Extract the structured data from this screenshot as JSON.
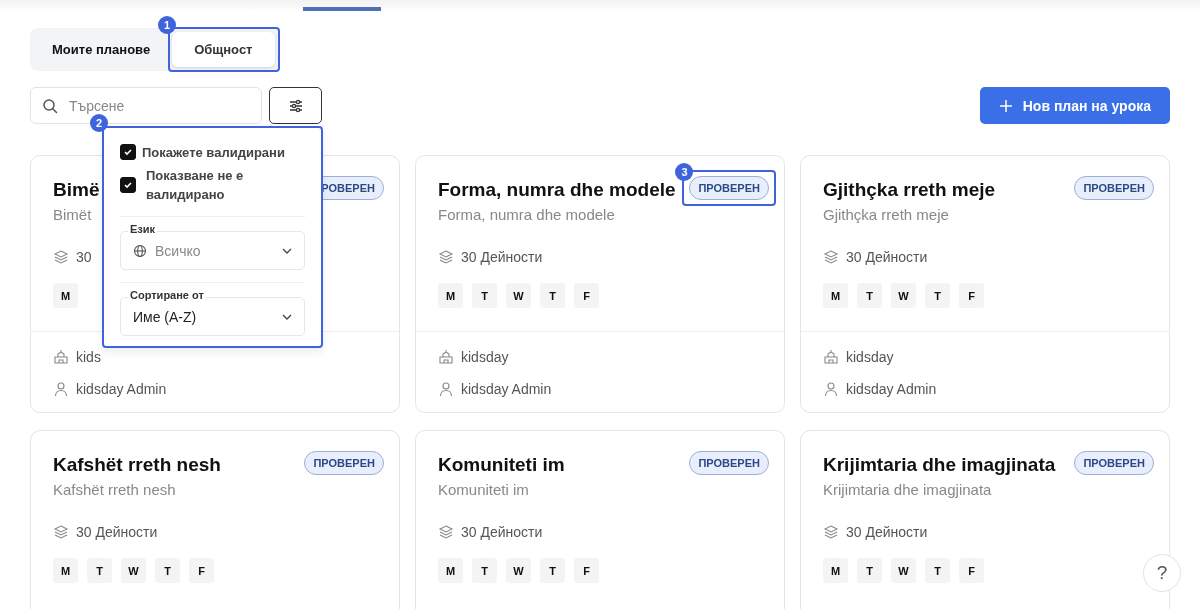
{
  "tabs": [
    {
      "label": "Моите планове",
      "selected": false
    },
    {
      "label": "Общност",
      "selected": true,
      "callout": "1"
    }
  ],
  "search": {
    "placeholder": "Търсене"
  },
  "new_button": {
    "label": "Нов план на урока"
  },
  "filter_panel": {
    "callout": "2",
    "checkboxes": [
      {
        "label": "Покажете валидирани",
        "checked": true
      },
      {
        "label": "Показване не е валидирано",
        "checked": true
      }
    ],
    "selects": [
      {
        "kind": "language",
        "label": "Език",
        "placeholder": "Всичко"
      },
      {
        "kind": "sort",
        "label": "Сортиране от",
        "value": "Име (A-Z)"
      }
    ]
  },
  "cards": [
    {
      "title": "Bimë",
      "subtitle": "Bimët",
      "activities": "30",
      "days": [
        "M"
      ],
      "badge": "РОВЕРЕН",
      "org": "kids",
      "author": "kidsday Admin"
    },
    {
      "title": "Forma, numra dhe modele",
      "subtitle": "Forma, numra dhe modele",
      "activities": "30 Дейности",
      "days": [
        "M",
        "T",
        "W",
        "T",
        "F"
      ],
      "badge": "ПРОВЕРЕН",
      "badge_callout": "3",
      "org": "kidsday",
      "author": "kidsday Admin"
    },
    {
      "title": "Gjithçka rreth meje",
      "subtitle": "Gjithçka rreth meje",
      "activities": "30 Дейности",
      "days": [
        "M",
        "T",
        "W",
        "T",
        "F"
      ],
      "badge": "ПРОВЕРЕН",
      "org": "kidsday",
      "author": "kidsday Admin"
    },
    {
      "title": "Kafshët rreth nesh",
      "subtitle": "Kafshët rreth nesh",
      "activities": "30 Дейности",
      "days": [
        "M",
        "T",
        "W",
        "T",
        "F"
      ],
      "badge": "ПРОВЕРЕН"
    },
    {
      "title": "Komuniteti im",
      "subtitle": "Komuniteti im",
      "activities": "30 Дейности",
      "days": [
        "M",
        "T",
        "W",
        "T",
        "F"
      ],
      "badge": "ПРОВЕРЕН"
    },
    {
      "title": "Krijimtaria dhe imagjinata",
      "subtitle": "Krijimtaria dhe imagjinata",
      "activities": "30 Дейности",
      "days": [
        "M",
        "T",
        "W",
        "T",
        "F"
      ],
      "badge": "ПРОВЕРЕН"
    }
  ],
  "help_button": {
    "label": "?"
  }
}
